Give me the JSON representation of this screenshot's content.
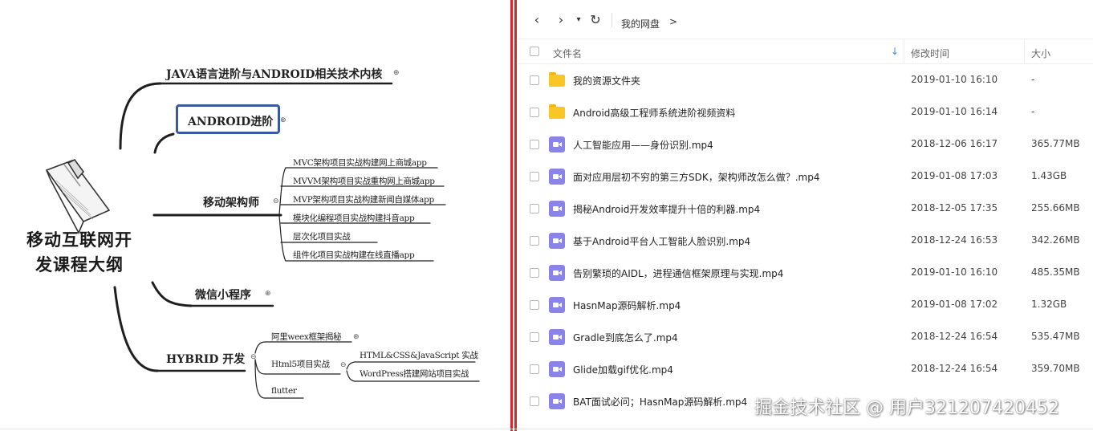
{
  "mindmap": {
    "central": {
      "line1": "移动互联网开",
      "line2": "发课程大纲"
    },
    "branches": {
      "java": "JAVA语言进阶与ANDROID相关技术内核",
      "android": "ANDROID进阶",
      "architect": "移动架构师",
      "miniprogram": "微信小程序",
      "hybrid": "HYBRID 开发"
    },
    "architect_items": [
      "MVC架构项目实战构建网上商城app",
      "MVVM架构项目实战重构网上商城app",
      "MVP架构项目实战构建新闻自媒体app",
      "模块化编程项目实战构建抖音app",
      "层次化项目实战",
      "组件化项目实战构建在线直播app"
    ],
    "hybrid_items": {
      "weex": "阿里weex框架揭秘",
      "html5": "Html5项目实战",
      "flutter": "flutter"
    },
    "html5_items": [
      "HTML&CSS&JavaScript 实战",
      "WordPress搭建网站项目实战"
    ],
    "toggle_symbol": "⊕",
    "collapse_symbol": "⊖"
  },
  "toolbar": {
    "back": "‹",
    "forward": "›",
    "dropdown": "▾",
    "refresh": "↻",
    "breadcrumb": "我的网盘",
    "breadcrumb_arrow": ">"
  },
  "columns": {
    "name": "文件名",
    "modified": "修改时间",
    "size": "大小",
    "sort_indicator": "↓"
  },
  "files": [
    {
      "name": "我的资源文件夹",
      "date": "2019-01-10 16:10",
      "size": "-",
      "type": "folder"
    },
    {
      "name": "Android高级工程师系统进阶视频资料",
      "date": "2019-01-10 16:14",
      "size": "-",
      "type": "folder"
    },
    {
      "name": "人工智能应用——身份识别.mp4",
      "date": "2018-12-06 16:17",
      "size": "365.77MB",
      "type": "video"
    },
    {
      "name": "面对应用层初不穷的第三方SDK，架构师改怎么做？.mp4",
      "date": "2019-01-08 17:03",
      "size": "1.43GB",
      "type": "video"
    },
    {
      "name": "揭秘Android开发效率提升十倍的利器.mp4",
      "date": "2018-12-05 17:35",
      "size": "255.66MB",
      "type": "video"
    },
    {
      "name": "基于Android平台人工智能人脸识别.mp4",
      "date": "2018-12-24 16:53",
      "size": "342.26MB",
      "type": "video"
    },
    {
      "name": "告别繁琐的AIDL，进程通信框架原理与实现.mp4",
      "date": "2019-01-10 16:10",
      "size": "485.35MB",
      "type": "video"
    },
    {
      "name": "HasnMap源码解析.mp4",
      "date": "2019-01-08 17:02",
      "size": "1.32GB",
      "type": "video"
    },
    {
      "name": "Gradle到底怎么了.mp4",
      "date": "2018-12-24 16:54",
      "size": "535.47MB",
      "type": "video"
    },
    {
      "name": "Glide加载gif优化.mp4",
      "date": "2018-12-24 16:54",
      "size": "359.70MB",
      "type": "video"
    },
    {
      "name": "BAT面试必问；HasnMap源码解析.mp4",
      "date": "",
      "size": "",
      "type": "video"
    }
  ],
  "watermark": "掘金技术社区 @ 用户3212074204​52",
  "colors": {
    "separator": "#d9262c",
    "selection": "#3a5aa0",
    "folder": "#f8c626",
    "video": "#8b83e8",
    "sort_accent": "#2f8de4"
  }
}
